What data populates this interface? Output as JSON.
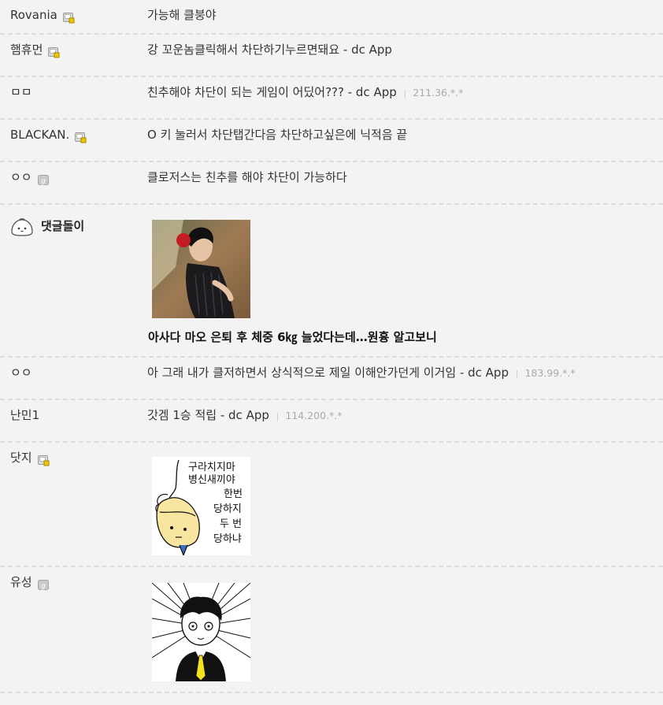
{
  "comments": [
    {
      "nick": "Rovania",
      "badge": "fixed",
      "text": "가능해 클붕야",
      "ip": ""
    },
    {
      "nick": "햄휴먼",
      "badge": "fixed",
      "text": "강 꼬운놈클릭해서 차단하기누르면돼요 - dc App",
      "ip": ""
    },
    {
      "nick": "ㅁㅁ",
      "badge": "",
      "text": "친추해야 차단이 되는 게임이 어딨어??? - dc App",
      "ip": "211.36.*.*"
    },
    {
      "nick": "BLACKAN.",
      "badge": "fixed",
      "text": "O 키 눌러서 차단탭간다음 차단하고싶은에 닉적음 끝",
      "ip": ""
    },
    {
      "nick": "ㅇㅇ",
      "badge": "guest",
      "text": "클로저스는 친추를 해야 차단이 가능하다",
      "ip": ""
    }
  ],
  "bot": {
    "nick": "댓글돌이",
    "ad_title": "아사다 마오 은퇴 후 체중 6㎏ 늘었다는데…원흉 알고보니"
  },
  "comments2": [
    {
      "nick": "ㅇㅇ",
      "badge": "",
      "text": "아 그래 내가 클저하면서 상식적으로 제일 이해안가던게 이거임 - dc App",
      "ip": "183.99.*.*"
    },
    {
      "nick": "난민1",
      "badge": "",
      "text": "갓겜 1승 적립 - dc App",
      "ip": "114.200.*.*"
    }
  ],
  "dccon1": {
    "nick": "닷지",
    "badge": "fixed",
    "lines": [
      "구라치지마",
      "병신새끼야",
      "한번",
      "당하지",
      "두 번",
      "당하냐"
    ]
  },
  "dccon2": {
    "nick": "유성",
    "badge": "guest"
  },
  "colors": {
    "background": "#f3f3f3",
    "divider": "#dcdcdc",
    "ip_text": "#aaaaaa",
    "tie_yellow": "#f4e21c"
  }
}
